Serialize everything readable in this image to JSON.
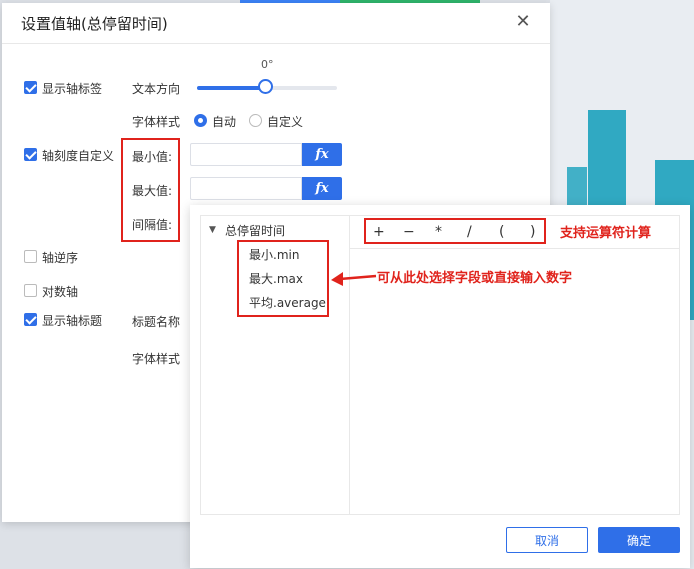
{
  "dialog": {
    "title": "设置值轴(总停留时间)",
    "close_icon": "close-icon"
  },
  "options": {
    "show_axis_label": {
      "label": "显示轴标签",
      "checked": true
    },
    "text_direction": {
      "label": "文本方向",
      "value": "0°",
      "slider_fraction": 0.5
    },
    "font_style": {
      "label": "字体样式",
      "options": [
        "自动",
        "自定义"
      ],
      "selected": "自动"
    },
    "axis_custom": {
      "label": "轴刻度自定义",
      "checked": true
    },
    "min": {
      "label": "最小值:",
      "value": ""
    },
    "max": {
      "label": "最大值:",
      "value": ""
    },
    "interval": {
      "label": "间隔值:"
    },
    "reverse": {
      "label": "轴逆序",
      "checked": false
    },
    "log": {
      "label": "对数轴",
      "checked": false
    },
    "show_title": {
      "label": "显示轴标题",
      "checked": true
    },
    "title_name": {
      "label": "标题名称"
    },
    "title_font_style": {
      "label": "字体样式"
    },
    "fx_label": "fx"
  },
  "panel": {
    "tree_root": "总停留时间",
    "tree_items": [
      "最小.min",
      "最大.max",
      "平均.average"
    ],
    "operators": [
      "+",
      "−",
      "*",
      "/",
      "(",
      ")"
    ],
    "cancel": "取消",
    "confirm": "确定"
  },
  "annotations": {
    "operators_note": "支持运算符计算",
    "fields_note": "可从此处选择字段或直接输入数字"
  },
  "colors": {
    "accent": "#2f6fe8",
    "annotation": "#e0231c"
  }
}
